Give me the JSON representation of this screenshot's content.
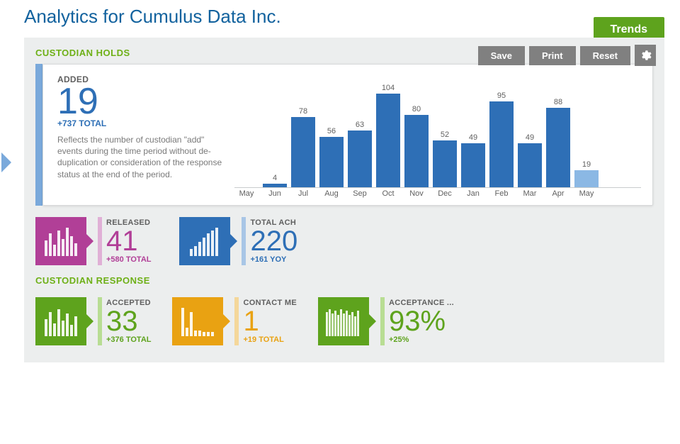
{
  "title": "Analytics for Cumulus Data Inc.",
  "tabs": {
    "trends": "Trends"
  },
  "toolbar": {
    "save": "Save",
    "print": "Print",
    "reset": "Reset"
  },
  "sections": {
    "holds_title": "CUSTODIAN HOLDS",
    "response_title": "CUSTODIAN RESPONSE"
  },
  "added": {
    "label": "ADDED",
    "value": "19",
    "sub": "+737 TOTAL",
    "desc": "Reflects the number of custodian \"add\" events during the time period without de-duplication or consideration of the response status at the end of the period."
  },
  "tiles": {
    "released": {
      "label": "RELEASED",
      "value": "41",
      "sub": "+580 TOTAL"
    },
    "totalach": {
      "label": "TOTAL ACH",
      "value": "220",
      "sub": "+161 YOY"
    },
    "accepted": {
      "label": "ACCEPTED",
      "value": "33",
      "sub": "+376 TOTAL"
    },
    "contact": {
      "label": "CONTACT ME",
      "value": "1",
      "sub": "+19 TOTAL"
    },
    "acceptance": {
      "label": "ACCEPTANCE ...",
      "value": "93%",
      "sub": "+25%"
    }
  },
  "chart_data": {
    "type": "bar",
    "title": "Custodian Holds – Added",
    "xlabel": "",
    "ylabel": "",
    "ylim": [
      0,
      110
    ],
    "categories": [
      "May",
      "Jun",
      "Jul",
      "Aug",
      "Sep",
      "Oct",
      "Nov",
      "Dec",
      "Jan",
      "Feb",
      "Mar",
      "Apr",
      "May"
    ],
    "values": [
      0,
      4,
      78,
      56,
      63,
      104,
      80,
      52,
      49,
      95,
      49,
      88,
      19
    ],
    "current_index": 12
  }
}
